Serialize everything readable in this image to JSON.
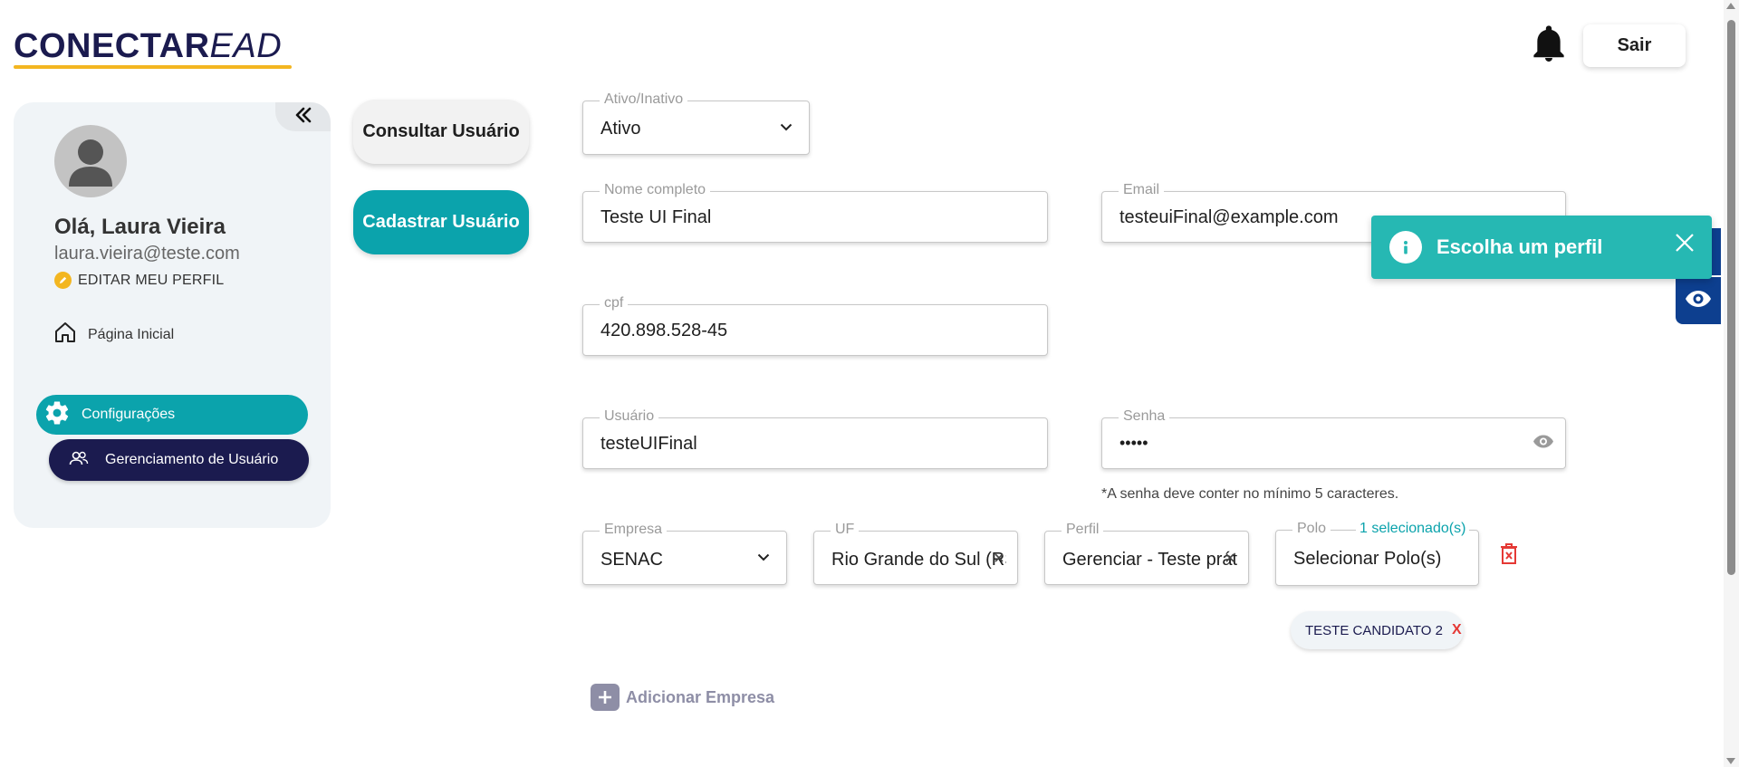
{
  "header": {
    "logo_strong": "CONECTAR",
    "logo_light": "EAD",
    "logout_label": "Sair",
    "notification_icon": "bell-icon"
  },
  "sidebar": {
    "greeting": "Olá, Laura Vieira",
    "email": "laura.vieira@teste.com",
    "edit_profile_label": "EDITAR MEU PERFIL",
    "home_label": "Página Inicial",
    "settings_label": "Configurações",
    "user_management_label": "Gerenciamento de Usuário",
    "collapse_icon": "double-chevron-left-icon"
  },
  "actions": {
    "consult_label": "Consultar Usuário",
    "register_label": "Cadastrar Usuário"
  },
  "form": {
    "status": {
      "label": "Ativo/Inativo",
      "value": "Ativo"
    },
    "full_name": {
      "label": "Nome completo",
      "value": "Teste UI Final"
    },
    "email": {
      "label": "Email",
      "value": "testeuiFinal@example.com"
    },
    "cpf": {
      "label": "cpf",
      "value": "420.898.528-45"
    },
    "username": {
      "label": "Usuário",
      "value": "testeUIFinal"
    },
    "password": {
      "label": "Senha",
      "value": "•••••",
      "hint": "*A senha deve conter no mínimo 5 caracteres."
    },
    "company": {
      "label": "Empresa",
      "value": "SENAC"
    },
    "uf": {
      "label": "UF",
      "value": "Rio Grande do Sul (RS)"
    },
    "profile": {
      "label": "Perfil",
      "value": "Gerenciar - Teste prática"
    },
    "polo": {
      "label": "Polo",
      "selected_count": "1 selecionado(s)",
      "value": "Selecionar Polo(s)"
    },
    "polo_chips": [
      {
        "label": "TESTE CANDIDATO 2",
        "remove": "X"
      }
    ],
    "add_company_label": "Adicionar Empresa"
  },
  "toast": {
    "message": "Escolha um perfil",
    "icon": "info-icon"
  },
  "colors": {
    "brand_navy": "#1b1b4f",
    "brand_teal": "#0ba3ac",
    "accent_yellow": "#f3b621",
    "toast_teal": "#26b8b3",
    "side_tab_blue": "#0d3f8f",
    "danger_red": "#e53935"
  }
}
